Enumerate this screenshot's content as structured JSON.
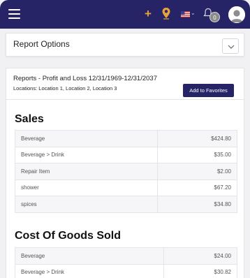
{
  "topbar": {
    "icons": [
      "hamburger-menu-icon",
      "plus-icon",
      "location-pin-icon",
      "us-flag-icon",
      "bell-icon",
      "avatar"
    ],
    "notification_count": "0",
    "colors": {
      "background": "#262466",
      "plus": "#e8a23a",
      "pin": "#e8a23a"
    }
  },
  "report_options": {
    "title": "Report Options",
    "toggle_icon": "chevron-down-icon"
  },
  "report": {
    "title": "Reports - Profit and Loss 12/31/1969-12/31/2037",
    "locations": "Locations: Location 1, Location 2, Location 3",
    "favorites_button": "Add to Favorites"
  },
  "sales": {
    "title": "Sales",
    "rows": [
      {
        "name": "Beverage",
        "amount": "$424.80"
      },
      {
        "name": "Beverage > Drink",
        "amount": "$35.00"
      },
      {
        "name": "Repair Item",
        "amount": "$2.00"
      },
      {
        "name": "shower",
        "amount": "$67.20"
      },
      {
        "name": "spices",
        "amount": "$34.80"
      }
    ]
  },
  "cogs": {
    "title": "Cost Of Goods Sold",
    "rows": [
      {
        "name": "Beverage",
        "amount": "$24.00"
      },
      {
        "name": "Beverage > Drink",
        "amount": "$30.82"
      }
    ]
  }
}
